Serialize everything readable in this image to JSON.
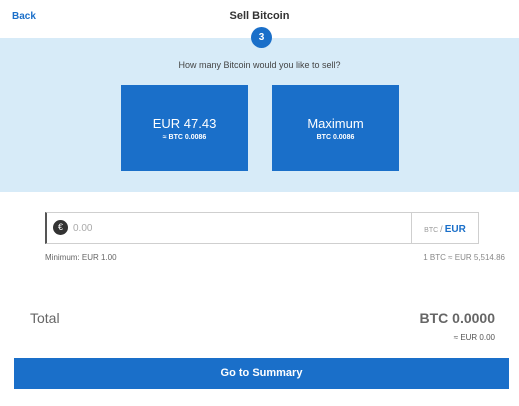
{
  "header": {
    "back_label": "Back",
    "title": "Sell Bitcoin",
    "step": "3"
  },
  "panel": {
    "question": "How many Bitcoin would you like to sell?",
    "options": [
      {
        "main": "EUR 47.43",
        "sub": "≈ BTC 0.0086"
      },
      {
        "main": "Maximum",
        "sub": "BTC 0.0086"
      }
    ]
  },
  "input": {
    "currency_symbol": "€",
    "placeholder": "0.00",
    "toggle_btc": "BTC",
    "toggle_sep": "/",
    "toggle_eur": "EUR"
  },
  "info": {
    "minimum": "Minimum: EUR 1.00",
    "rate": "1 BTC ≈ EUR 5,514.86"
  },
  "total": {
    "label": "Total",
    "btc": "BTC 0.0000",
    "eur": "≈ EUR 0.00"
  },
  "actions": {
    "summary_label": "Go to Summary"
  },
  "colors": {
    "accent": "#1a6fc9",
    "panel_bg": "#d7ebf8"
  }
}
